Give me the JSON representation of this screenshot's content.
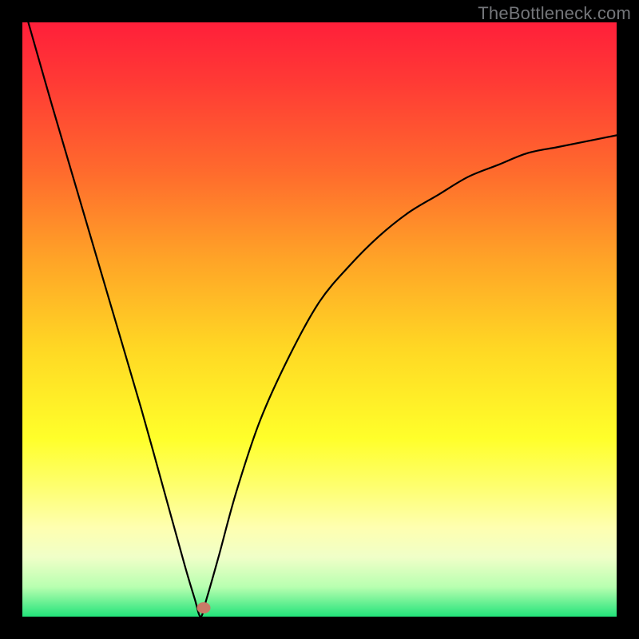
{
  "watermark": "TheBottleneck.com",
  "chart_data": {
    "type": "line",
    "title": "",
    "xlabel": "",
    "ylabel": "",
    "xlim": [
      0,
      1
    ],
    "ylim": [
      0,
      1
    ],
    "grid": false,
    "legend": false,
    "series": [
      {
        "name": "curve",
        "x": [
          0.01,
          0.05,
          0.1,
          0.15,
          0.2,
          0.25,
          0.275,
          0.29,
          0.3,
          0.31,
          0.33,
          0.36,
          0.4,
          0.45,
          0.5,
          0.55,
          0.6,
          0.65,
          0.7,
          0.75,
          0.8,
          0.85,
          0.9,
          0.95,
          1.0
        ],
        "y": [
          1.0,
          0.86,
          0.69,
          0.52,
          0.35,
          0.17,
          0.08,
          0.03,
          0.0,
          0.03,
          0.1,
          0.21,
          0.33,
          0.44,
          0.53,
          0.59,
          0.64,
          0.68,
          0.71,
          0.74,
          0.76,
          0.78,
          0.79,
          0.8,
          0.81
        ]
      }
    ],
    "marker": {
      "x": 0.305,
      "y": 0.015
    },
    "background_gradient": {
      "top_color": "#ff1f3a",
      "bottom_color": "#22e37a"
    }
  }
}
